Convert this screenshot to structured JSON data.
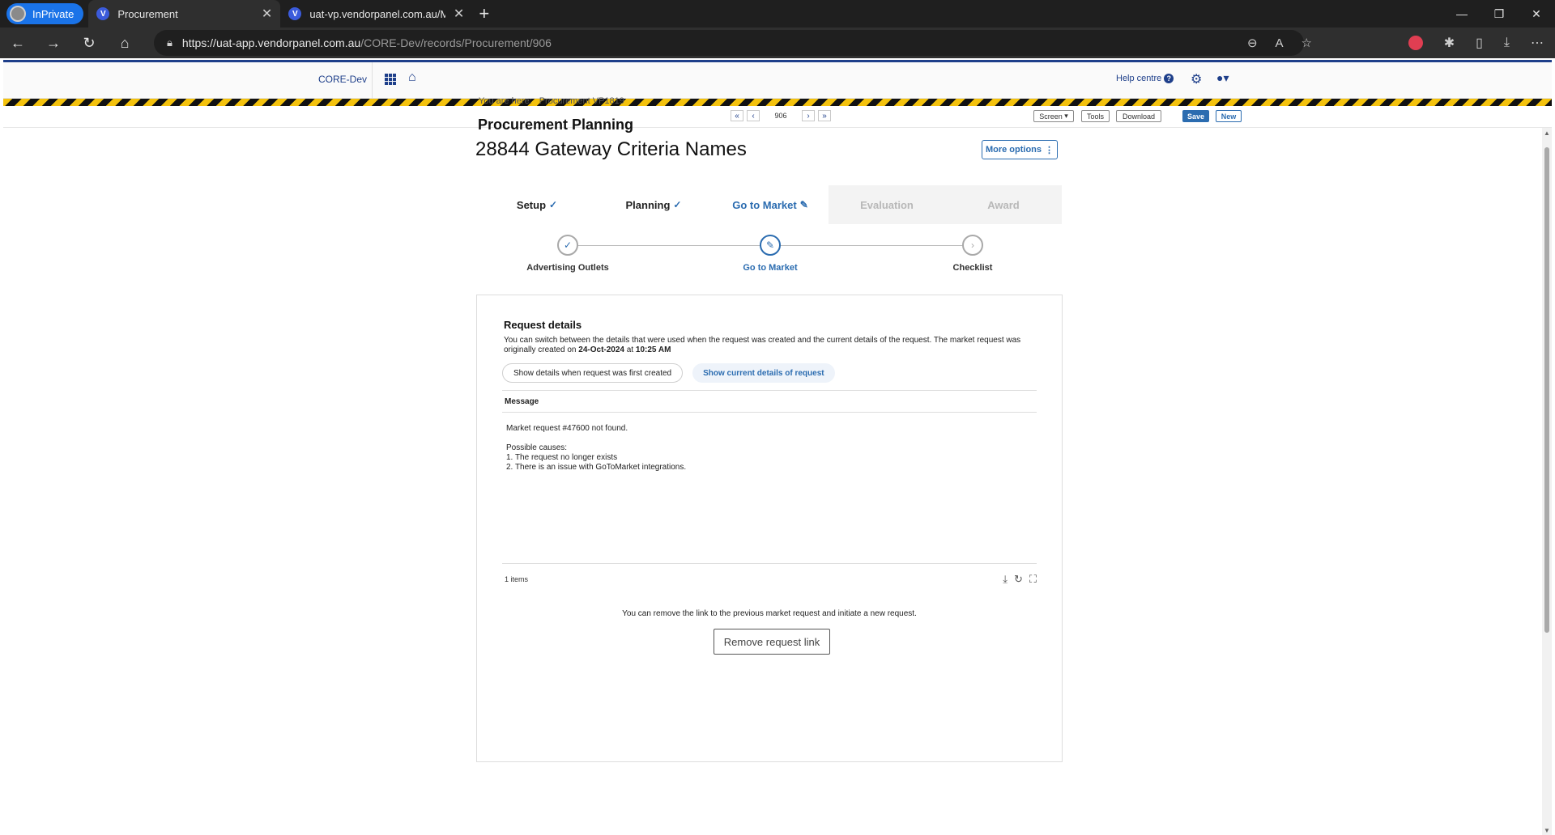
{
  "browser": {
    "inprivate_label": "InPrivate",
    "tabs": [
      {
        "title": "Procurement",
        "active": true
      },
      {
        "title": "uat-vp.vendorpanel.com.au/Mem",
        "active": false
      }
    ],
    "url_host": "https://uat-app.vendorpanel.com.au",
    "url_path": "/CORE-Dev/records/Procurement/906"
  },
  "header": {
    "instance": "CORE-Dev",
    "help_label": "Help centre"
  },
  "toolbar": {
    "record_number": "906",
    "view_select": "Screen",
    "tools_label": "Tools",
    "download_label": "Download",
    "save_label": "Save",
    "new_label": "New"
  },
  "breadcrumb": {
    "prefix": "You are here:",
    "item": "Procurement VP1819"
  },
  "page": {
    "subtitle": "Procurement Planning",
    "title": "28844 Gateway Criteria Names",
    "more_options_label": "More options"
  },
  "stages": [
    {
      "label": "Setup",
      "state": "done"
    },
    {
      "label": "Planning",
      "state": "done"
    },
    {
      "label": "Go to Market",
      "state": "active"
    },
    {
      "label": "Evaluation",
      "state": "future"
    },
    {
      "label": "Award",
      "state": "future"
    }
  ],
  "steps": [
    {
      "label": "Advertising Outlets",
      "state": "done"
    },
    {
      "label": "Go to Market",
      "state": "current"
    },
    {
      "label": "Checklist",
      "state": "pending"
    }
  ],
  "request_details": {
    "heading": "Request details",
    "description": "You can switch between the details that were used when the request was created and the current details of the request. The market request was originally created on",
    "created_date": "24-Oct-2024",
    "created_at_word": "at",
    "created_time": "10:25 AM",
    "toggle_original": "Show details when request was first created",
    "toggle_current": "Show current details of request",
    "grid_column": "Message",
    "message": "Market request #47600 not found.\n\nPossible causes:\n1. The request no longer exists\n2. There is an issue with GoToMarket integrations.",
    "items_count": "1 items",
    "remove_note": "You can remove the link to the previous market request and initiate a new request.",
    "remove_button": "Remove request link"
  },
  "colors": {
    "brand_blue": "#2b6cb0",
    "navy": "#1e3f8a",
    "hazard_yellow": "#f4c20d"
  }
}
